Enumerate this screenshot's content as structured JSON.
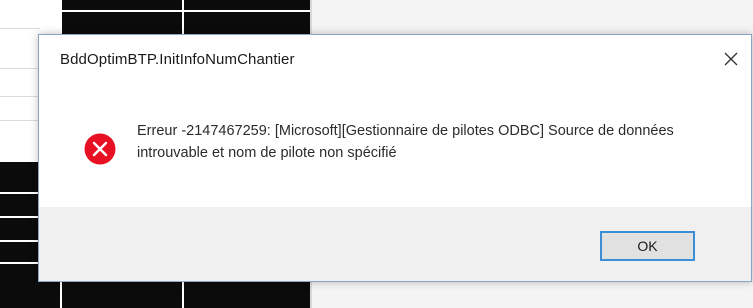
{
  "dialog": {
    "title": "BddOptimBTP.InitInfoNumChantier",
    "message": "Erreur -2147467259: [Microsoft][Gestionnaire de pilotes ODBC] Source de données introuvable et nom de pilote non spécifié",
    "ok_label": "OK",
    "icon": "error-icon",
    "close_glyph": "✕"
  },
  "colors": {
    "error_red": "#e81123",
    "button_border": "#3c8ed6",
    "footer_bg": "#f0f0f0"
  }
}
